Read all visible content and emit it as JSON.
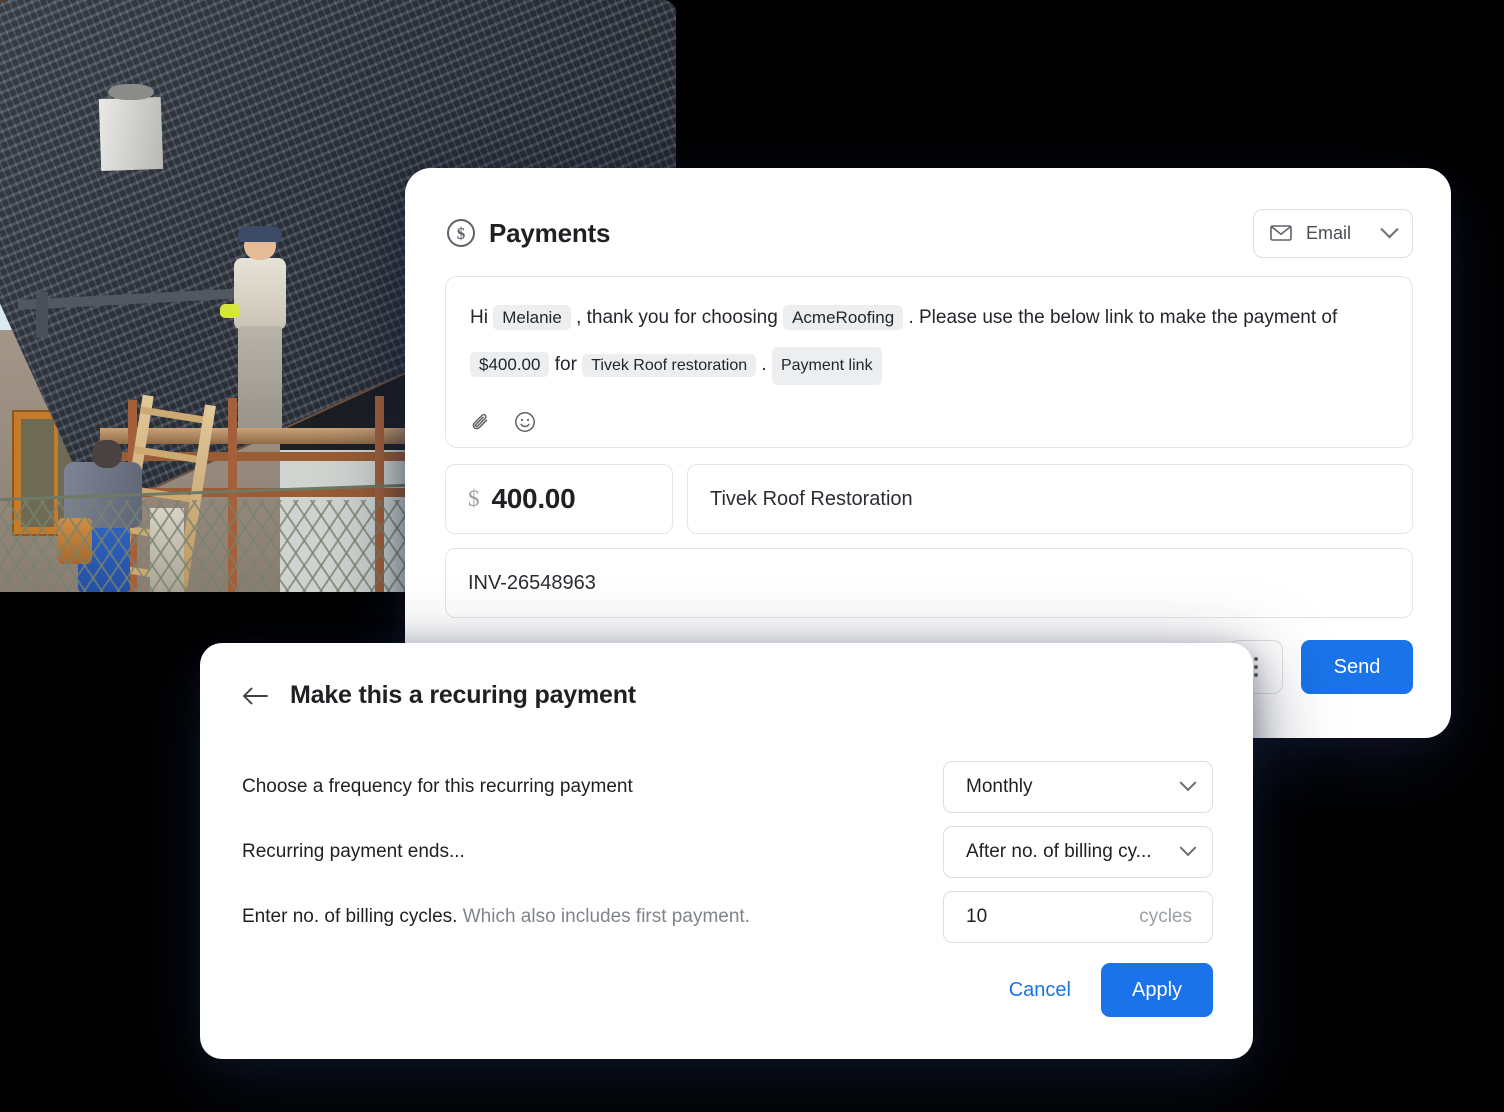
{
  "photo": {
    "alt": "Two roofers working on a house with dark tiled roof and scaffolding"
  },
  "payments_card": {
    "title": "Payments",
    "title_icon": "dollar-circle-icon",
    "channel_select": {
      "icon": "envelope-icon",
      "value": "Email",
      "chevron": "chevron-down-icon"
    },
    "message": {
      "line1_prefix": "Hi",
      "chip_name": "Melanie",
      "line1_mid": ", thank you for choosing",
      "chip_company": "AcmeRoofing",
      "line1_suffix": ". Please use the below link to make the payment",
      "line2_prefix": "of",
      "chip_amount": "$400.00",
      "line2_mid": "for",
      "chip_service": "Tivek Roof restoration",
      "line2_suffix": ".",
      "chip_link": "Payment link",
      "tools": [
        "attachment-icon",
        "emoji-icon"
      ]
    },
    "amount_field": {
      "currency_symbol": "$",
      "value": "400.00"
    },
    "description_field": {
      "value": "Tivek Roof Restoration"
    },
    "invoice_field": {
      "value": "INV-26548963"
    },
    "more_button_icon": "kebab-menu-icon",
    "send_label": "Send"
  },
  "recurring_modal": {
    "back_icon": "arrow-left-icon",
    "title": "Make this a recuring payment",
    "rows": [
      {
        "label": "Choose a frequency for this recurring payment",
        "label_muted": "",
        "control_type": "select",
        "value": "Monthly"
      },
      {
        "label": "Recurring payment ends...",
        "label_muted": "",
        "control_type": "select",
        "value": "After no. of billing cy..."
      },
      {
        "label": "Enter no. of billing cycles.",
        "label_muted": " Which also includes first payment.",
        "control_type": "number",
        "value": "10",
        "unit": "cycles"
      }
    ],
    "cancel_label": "Cancel",
    "apply_label": "Apply"
  },
  "colors": {
    "accent_blue": "#1a73e8",
    "chip_bg": "#eceef0",
    "border": "#dcdee1",
    "text_primary": "#1f2023",
    "text_muted": "#80858c",
    "page_background": "#000000"
  }
}
